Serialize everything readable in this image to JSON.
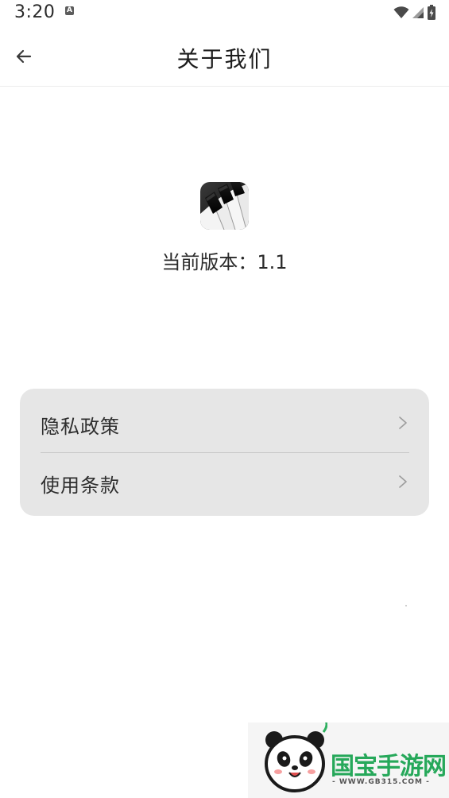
{
  "status_bar": {
    "time": "3:20",
    "notification_icon": "a-letter-icon",
    "icons": [
      "wifi-icon",
      "signal-icon",
      "battery-icon"
    ]
  },
  "app_bar": {
    "back_icon": "arrow-left-icon",
    "title": "关于我们"
  },
  "app_info": {
    "icon": "piano-keys-icon",
    "version_text": "当前版本：1.1"
  },
  "menu": {
    "items": [
      {
        "label": "隐私政策",
        "icon": "chevron-right-icon"
      },
      {
        "label": "使用条款",
        "icon": "chevron-right-icon"
      }
    ]
  },
  "watermark": {
    "logo": "panda-logo",
    "brand": "国宝手游网",
    "url": "- WWW.GB315.COM -"
  },
  "colors": {
    "background": "#ffffff",
    "card_background": "#e6e6e6",
    "text_primary": "#1c1c1c",
    "watermark_brand": "#26a85a"
  }
}
